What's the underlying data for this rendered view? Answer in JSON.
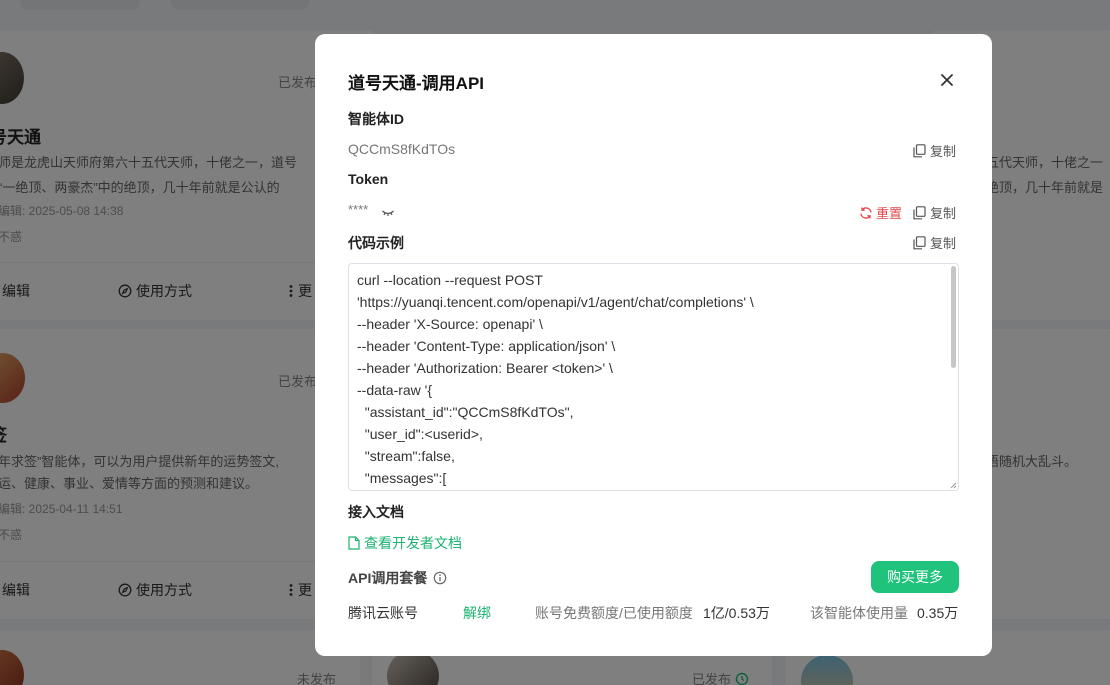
{
  "background": {
    "cards": [
      {
        "status": "已发布",
        "title": "号天通",
        "desc_line1": "师是龙虎山天师府第六十五代天师，十佬之一，道号",
        "desc_line2": "“一绝顶、两豪杰”中的绝顶，几十年前就是公认的",
        "edit_time": "编辑: 2025-05-08 14:38",
        "extra": "不惑",
        "edit_label": "编辑",
        "usage_label": "使用方式",
        "more_label": "更"
      },
      {
        "status": "已发布",
        "title": "签",
        "desc_line1": "年求签”智能体，可以为用户提供新年的运势签文,",
        "desc_line2": "运、健康、事业、爱情等方面的预测和建议。",
        "edit_time": "编辑: 2025-04-11 14:51",
        "extra": "不惑",
        "edit_label": "编辑",
        "usage_label": "使用方式",
        "more_label": "更"
      }
    ],
    "right_texts": [
      "五代天师，十佬之一",
      "绝顶，几十年前就是",
      "语随机大乱斗。"
    ],
    "bottom_statuses": [
      "未发布",
      "已发布"
    ]
  },
  "modal": {
    "title": "道号天通-调用API",
    "agent_id_label": "智能体ID",
    "agent_id": "QCCmS8fKdTOs",
    "copy_label": "复制",
    "token_label": "Token",
    "token_masked": "****",
    "reset_label": "重置",
    "code_label": "代码示例",
    "code_sample": "curl --location --request POST\n'https://yuanqi.tencent.com/openapi/v1/agent/chat/completions' \\\n--header 'X-Source: openapi' \\\n--header 'Content-Type: application/json' \\\n--header 'Authorization: Bearer <token>' \\\n--data-raw '{\n  \"assistant_id\":\"QCCmS8fKdTOs\",\n  \"user_id\":<userid>,\n  \"stream\":false,\n  \"messages\":[\n    {",
    "docs_label": "接入文档",
    "docs_link": "查看开发者文档",
    "package_label": "API调用套餐",
    "buy_more": "购买更多",
    "cloud_account": "腾讯云账号",
    "unbind": "解绑",
    "quota_label": "账号免费额度/已使用额度",
    "quota_value": "1亿/0.53万",
    "agent_usage_label": "该智能体使用量",
    "agent_usage_value": "0.35万"
  },
  "colors": {
    "accent_green": "#1fc37c",
    "link_green": "#1ab370",
    "reset_red": "#e5484d",
    "overlay": "rgba(0,0,0,0.5)"
  },
  "icons": [
    "close-icon",
    "copy-icon",
    "eye-closed-icon",
    "refresh-icon",
    "file-icon",
    "info-icon",
    "edit-icon",
    "compass-icon",
    "more-vertical-icon",
    "history-icon"
  ]
}
